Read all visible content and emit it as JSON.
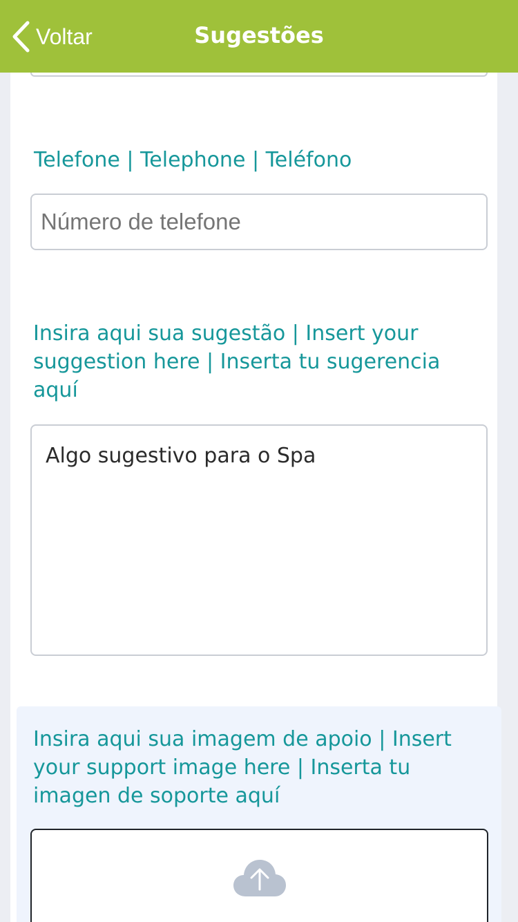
{
  "nav": {
    "back_label": "Voltar",
    "title": "Sugestões"
  },
  "phone": {
    "label": "Telefone | Telephone | Teléfono",
    "placeholder": "Número de telefone"
  },
  "suggestion": {
    "label": "Insira aqui sua sugestão | Insert your suggestion here | Inserta tu sugerencia aquí",
    "value": "Algo sugestivo para o Spa"
  },
  "image": {
    "label": "Insira aqui sua imagem de apoio | Insert your support image here | Inserta tu imagen de soporte aquí",
    "upload_icon": "cloud-upload-icon"
  },
  "colors": {
    "navbar": "#9fc13a",
    "label": "#16979a",
    "upload_panel": "#eff4fd"
  }
}
